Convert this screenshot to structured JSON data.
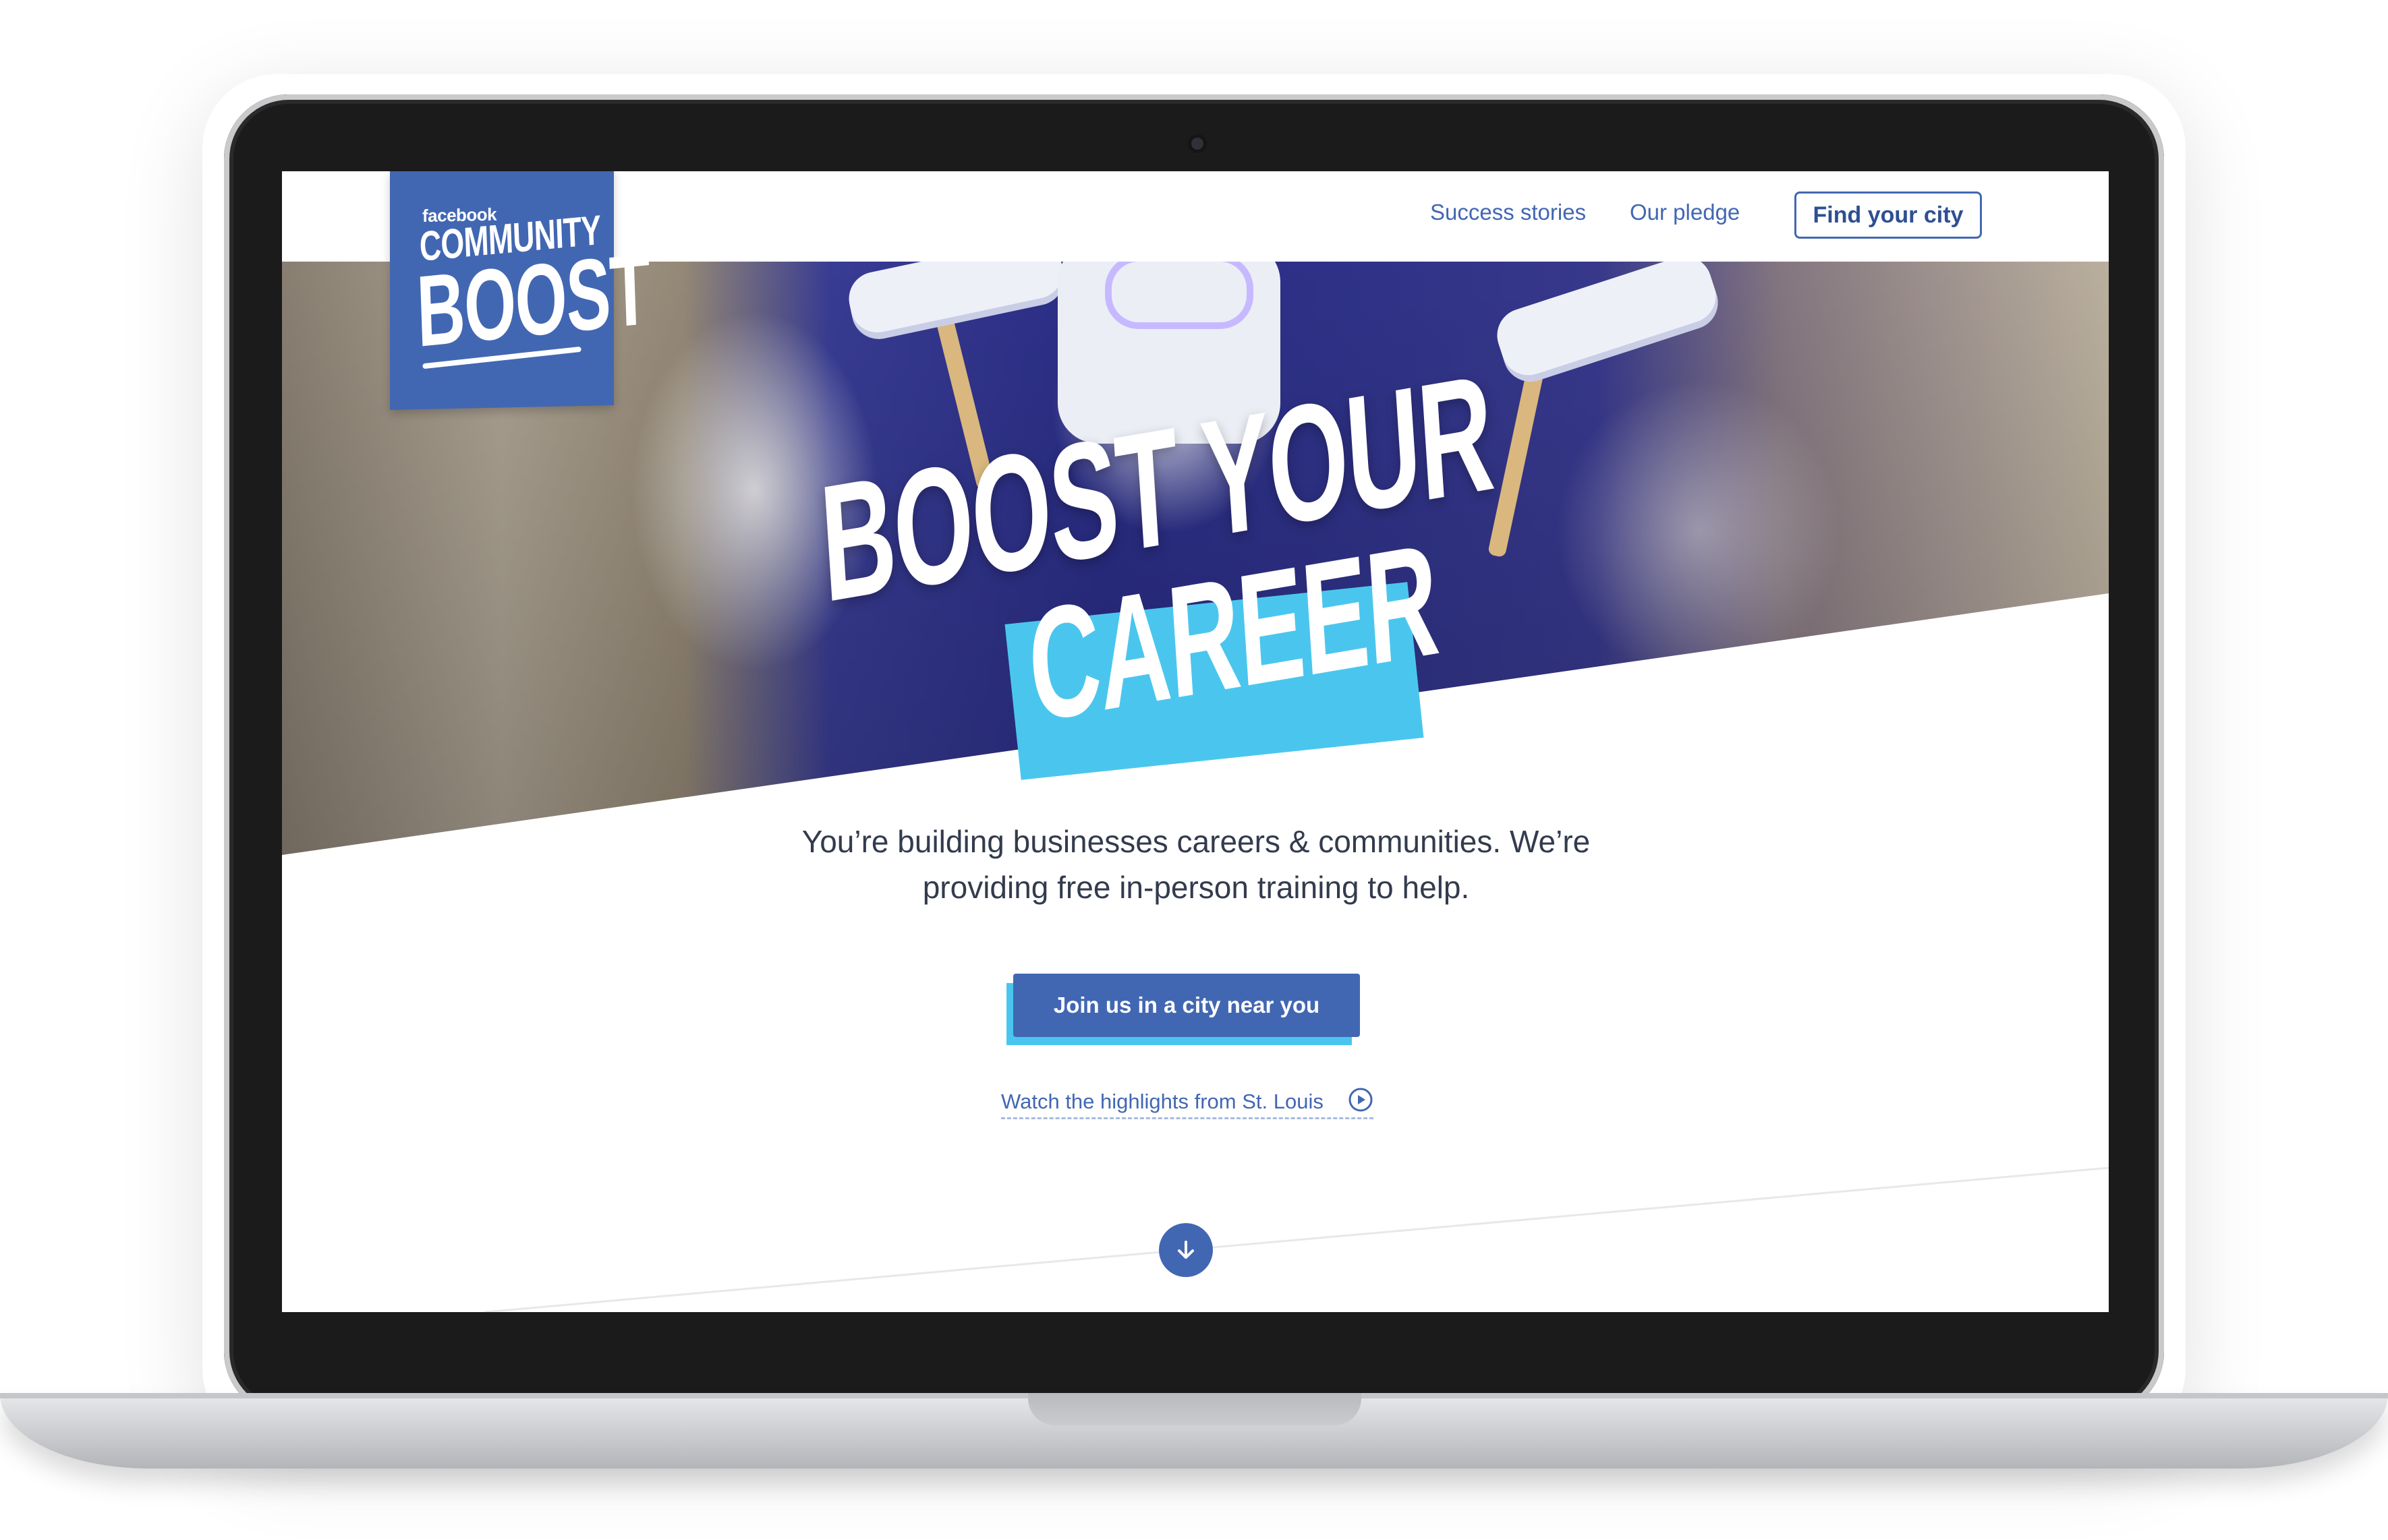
{
  "logo": {
    "brand": "facebook",
    "line1": "COMMUNITY",
    "line2": "BOOST"
  },
  "nav": {
    "links": [
      "Success stories",
      "Our pledge"
    ],
    "cta": "Find your city"
  },
  "hero": {
    "headline_line1": "BOOST YOUR",
    "headline_line2": "CAREER"
  },
  "main": {
    "tagline": "You’re building businesses careers & communities. We’re providing free in-person training to help.",
    "cta": "Join us in a city near you",
    "video_link": "Watch the highlights from St. Louis"
  },
  "icons": {
    "play": "play-circle-icon",
    "scroll": "arrow-down-icon"
  },
  "colors": {
    "brand_blue": "#4267b2",
    "accent_cyan": "#4ac6ee",
    "text_dark": "#333b4d"
  }
}
